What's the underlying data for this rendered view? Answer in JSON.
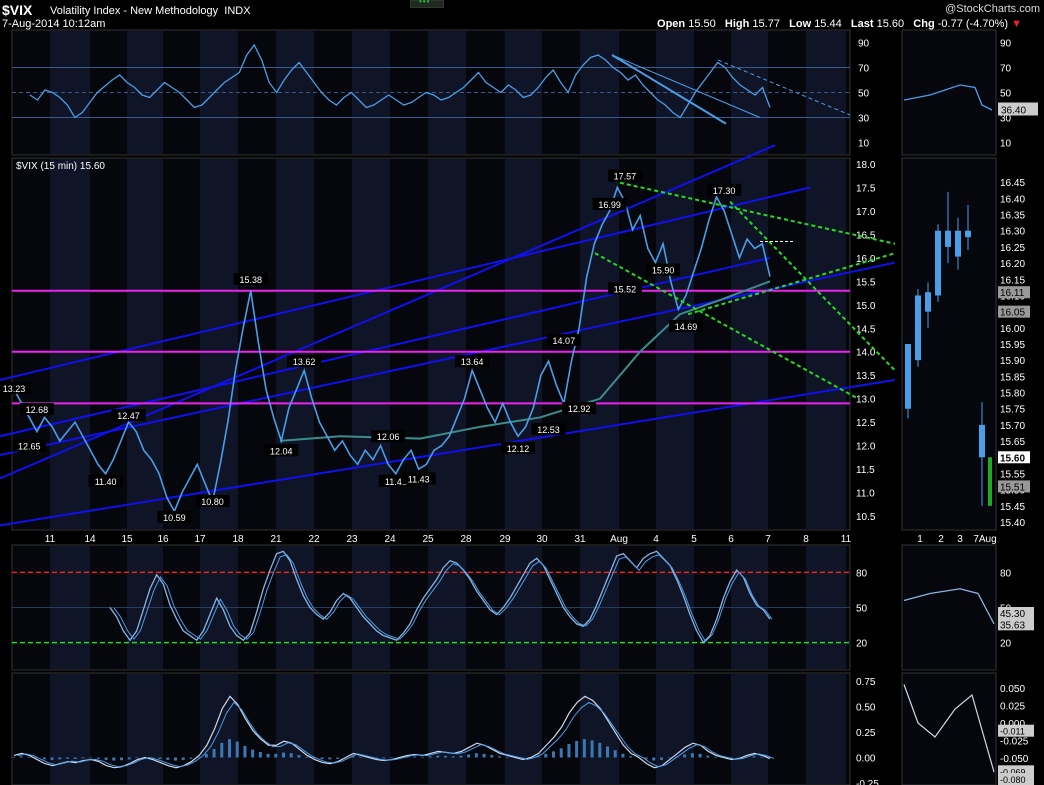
{
  "header": {
    "ticker": "$VIX",
    "name": "Volatility Index - New Methodology",
    "exchange": "INDX",
    "date": "7-Aug-2014 10:12am",
    "credit": "@StockCharts.com",
    "open_label": "Open",
    "open": "15.50",
    "high_label": "High",
    "high": "15.77",
    "low_label": "Low",
    "low": "15.44",
    "last_label": "Last",
    "last": "15.60",
    "chg_label": "Chg",
    "chg": "-0.77 (-4.70%)",
    "down_icon": "triangle-down-icon",
    "price_panel_title": "$VIX (15 min) 15.60"
  },
  "colors": {
    "background": "#000000",
    "panel_bg": "#06070c",
    "shade": "#0f1426",
    "price": "#4a9ee8",
    "trend_blue": "#1010ee",
    "magenta": "#ee22ee",
    "green_dotted": "#22dd22",
    "red_dashed": "#ee2222",
    "ma_teal": "#3c8c8c",
    "grid_text": "#ffffff"
  },
  "chart_data": {
    "type": "line",
    "price_axis": {
      "ylim": [
        10.5,
        18.0
      ],
      "ticks": [
        "18.0",
        "17.5",
        "17.0",
        "16.5",
        "16.0",
        "15.5",
        "15.0",
        "14.5",
        "14.0",
        "13.5",
        "13.0",
        "12.5",
        "12.0",
        "11.5",
        "11.0",
        "10.5"
      ]
    },
    "x_labels": [
      "11",
      "14",
      "15",
      "16",
      "17",
      "18",
      "21",
      "22",
      "23",
      "24",
      "25",
      "28",
      "29",
      "30",
      "31",
      "Aug",
      "4",
      "5",
      "6",
      "7",
      "8",
      "11"
    ],
    "right_x_labels": [
      "1",
      "2",
      "3",
      "7Aug"
    ],
    "price_series": [
      13.2,
      12.9,
      12.6,
      12.3,
      12.6,
      12.4,
      12.1,
      12.3,
      12.5,
      12.2,
      11.9,
      11.6,
      11.4,
      11.7,
      12.1,
      12.5,
      12.3,
      11.9,
      11.7,
      11.4,
      10.9,
      10.6,
      11.0,
      11.3,
      11.6,
      11.2,
      10.8,
      11.6,
      12.5,
      13.6,
      14.5,
      15.3,
      14.2,
      13.2,
      12.6,
      12.1,
      12.8,
      13.2,
      13.6,
      13.0,
      12.5,
      12.2,
      11.9,
      12.1,
      11.8,
      11.6,
      11.9,
      11.7,
      12.0,
      11.6,
      11.4,
      11.7,
      11.9,
      11.5,
      11.6,
      11.9,
      12.0,
      12.2,
      12.6,
      13.0,
      13.6,
      13.2,
      12.8,
      12.5,
      12.9,
      12.5,
      12.2,
      12.4,
      12.8,
      13.5,
      13.8,
      13.3,
      12.9,
      13.8,
      14.5,
      15.6,
      16.3,
      16.7,
      17.0,
      17.5,
      17.2,
      16.6,
      16.9,
      16.2,
      15.9,
      16.3,
      15.5,
      14.9,
      15.2,
      15.7,
      16.2,
      16.8,
      17.3,
      17.0,
      16.5,
      16.0,
      16.4,
      16.2,
      16.3,
      15.6
    ],
    "price_labels": [
      {
        "text": "13.23",
        "x_index": 0,
        "value": 13.23
      },
      {
        "text": "12.68",
        "x_index": 3,
        "value": 12.78
      },
      {
        "text": "12.65",
        "x_index": 2,
        "value": 12.0
      },
      {
        "text": "11.40",
        "x_index": 12,
        "value": 11.25
      },
      {
        "text": "12.47",
        "x_index": 15,
        "value": 12.65
      },
      {
        "text": "10.59",
        "x_index": 21,
        "value": 10.48
      },
      {
        "text": "10.80",
        "x_index": 26,
        "value": 10.82
      },
      {
        "text": "15.38",
        "x_index": 31,
        "value": 15.55
      },
      {
        "text": "12.04",
        "x_index": 35,
        "value": 11.9
      },
      {
        "text": "13.62",
        "x_index": 38,
        "value": 13.8
      },
      {
        "text": "12.06",
        "x_index": 49,
        "value": 12.2
      },
      {
        "text": "11.41",
        "x_index": 50,
        "value": 11.25
      },
      {
        "text": "11.43",
        "x_index": 53,
        "value": 11.3
      },
      {
        "text": "13.64",
        "x_index": 60,
        "value": 13.8
      },
      {
        "text": "12.12",
        "x_index": 66,
        "value": 11.95
      },
      {
        "text": "12.53",
        "x_index": 70,
        "value": 12.35
      },
      {
        "text": "14.07",
        "x_index": 72,
        "value": 14.25
      },
      {
        "text": "12.92",
        "x_index": 74,
        "value": 12.8
      },
      {
        "text": "16.99",
        "x_index": 78,
        "value": 17.15
      },
      {
        "text": "17.57",
        "x_index": 80,
        "value": 17.75
      },
      {
        "text": "15.52",
        "x_index": 80,
        "value": 15.35
      },
      {
        "text": "15.90",
        "x_index": 85,
        "value": 15.75
      },
      {
        "text": "14.69",
        "x_index": 88,
        "value": 14.55
      },
      {
        "text": "17.30",
        "x_index": 93,
        "value": 17.45
      }
    ],
    "horizontal_lines": [
      15.3,
      14.0,
      12.9
    ],
    "right_price_axis": {
      "ylim": [
        15.4,
        16.5
      ],
      "ticks": [
        "16.45",
        "16.40",
        "16.35",
        "16.30",
        "16.25",
        "16.20",
        "16.15",
        "16.10",
        "16.05",
        "16.00",
        "15.95",
        "15.90",
        "15.85",
        "15.80",
        "15.75",
        "15.70",
        "15.65",
        "15.60",
        "15.55",
        "15.50",
        "15.45",
        "15.40"
      ],
      "tags": [
        "16.11",
        "16.05",
        "15.60",
        "15.51"
      ]
    },
    "top_indicator": {
      "ticks": [
        "90",
        "70",
        "50",
        "30",
        "10"
      ],
      "ylim": [
        0,
        100
      ],
      "right_tags": [
        "36.40"
      ],
      "series": [
        48,
        44,
        52,
        50,
        46,
        40,
        30,
        34,
        42,
        50,
        55,
        60,
        64,
        58,
        54,
        48,
        46,
        52,
        58,
        54,
        50,
        44,
        38,
        40,
        46,
        52,
        58,
        62,
        66,
        80,
        88,
        76,
        58,
        50,
        60,
        68,
        74,
        66,
        58,
        50,
        44,
        40,
        46,
        50,
        44,
        38,
        40,
        44,
        48,
        44,
        40,
        42,
        46,
        50,
        48,
        44,
        46,
        50,
        54,
        60,
        66,
        58,
        54,
        50,
        56,
        52,
        46,
        48,
        54,
        62,
        68,
        58,
        50,
        64,
        72,
        78,
        80,
        76,
        70,
        66,
        60,
        64,
        56,
        50,
        44,
        40,
        34,
        30,
        40,
        50,
        58,
        66,
        74,
        70,
        62,
        56,
        52,
        48,
        54,
        38
      ]
    },
    "stoch_panel": {
      "ticks": [
        "80",
        "50",
        "20"
      ],
      "ylim": [
        0,
        100
      ],
      "right_tags": [
        "45.30",
        "35.63"
      ],
      "series": [
        50,
        42,
        30,
        22,
        30,
        48,
        66,
        78,
        70,
        52,
        40,
        30,
        26,
        22,
        30,
        44,
        58,
        48,
        34,
        26,
        22,
        28,
        46,
        66,
        82,
        96,
        98,
        90,
        74,
        60,
        50,
        44,
        40,
        46,
        56,
        62,
        58,
        50,
        42,
        36,
        30,
        26,
        24,
        22,
        28,
        36,
        48,
        58,
        66,
        74,
        84,
        90,
        88,
        82,
        74,
        64,
        56,
        48,
        44,
        50,
        58,
        68,
        78,
        88,
        92,
        86,
        74,
        62,
        50,
        42,
        36,
        34,
        40,
        52,
        66,
        80,
        94,
        96,
        90,
        84,
        92,
        96,
        98,
        92,
        86,
        74,
        60,
        44,
        30,
        20,
        26,
        40,
        58,
        72,
        82,
        76,
        62,
        52,
        48,
        40
      ]
    },
    "macd_panel": {
      "ticks": [
        "0.75",
        "0.50",
        "0.25",
        "0.00",
        "-0.25"
      ],
      "ylim": [
        -0.25,
        0.75
      ],
      "right_ticks": [
        "0.050",
        "0.025",
        "0.000",
        "-0.025",
        "-0.050",
        "-0.075"
      ],
      "right_tags": [
        "-0.011",
        "-0.069",
        "-0.080"
      ],
      "series": [
        0.02,
        0.04,
        0.02,
        -0.02,
        -0.06,
        -0.08,
        -0.06,
        -0.04,
        -0.05,
        -0.03,
        -0.02,
        -0.04,
        -0.08,
        -0.1,
        -0.09,
        -0.06,
        -0.02,
        0.0,
        -0.02,
        -0.05,
        -0.08,
        -0.1,
        -0.08,
        -0.04,
        0.02,
        0.12,
        0.28,
        0.48,
        0.6,
        0.52,
        0.38,
        0.26,
        0.18,
        0.12,
        0.12,
        0.16,
        0.14,
        0.08,
        0.02,
        -0.02,
        -0.05,
        -0.06,
        -0.04,
        0.0,
        0.04,
        0.02,
        0.0,
        -0.02,
        -0.03,
        -0.02,
        0.0,
        0.02,
        0.03,
        0.02,
        0.04,
        0.06,
        0.05,
        0.04,
        0.06,
        0.1,
        0.14,
        0.12,
        0.08,
        0.04,
        0.02,
        0.0,
        -0.02,
        0.0,
        0.04,
        0.12,
        0.2,
        0.3,
        0.44,
        0.54,
        0.6,
        0.56,
        0.48,
        0.36,
        0.24,
        0.12,
        0.04,
        0.0,
        -0.06,
        -0.1,
        -0.08,
        -0.02,
        0.04,
        0.1,
        0.14,
        0.12,
        0.06,
        0.02,
        0.0,
        -0.02,
        -0.01,
        0.02,
        0.04,
        0.02,
        -0.01
      ]
    }
  }
}
